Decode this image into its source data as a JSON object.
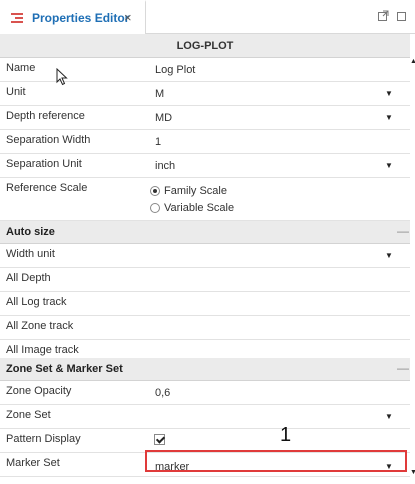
{
  "tab": {
    "title": "Properties Editor",
    "close": "×"
  },
  "header": {
    "title": "LOG-PLOT"
  },
  "rows": {
    "name": {
      "label": "Name",
      "value": "Log Plot"
    },
    "unit": {
      "label": "Unit",
      "value": "M"
    },
    "depth_reference": {
      "label": "Depth reference",
      "value": "MD"
    },
    "separation_width": {
      "label": "Separation Width",
      "value": "1"
    },
    "separation_unit": {
      "label": "Separation Unit",
      "value": "inch"
    },
    "reference_scale": {
      "label": "Reference Scale",
      "options": [
        "Family Scale",
        "Variable Scale"
      ],
      "selected": "Family Scale"
    }
  },
  "auto_size": {
    "title": "Auto size",
    "collapse": "—",
    "rows": {
      "width_unit": {
        "label": "Width unit",
        "value": ""
      },
      "all_depth": {
        "label": "All Depth"
      },
      "all_log_track": {
        "label": "All Log track"
      },
      "all_zone_track": {
        "label": "All Zone track"
      },
      "all_image_track": {
        "label": "All Image track"
      }
    }
  },
  "zone_marker": {
    "title": "Zone Set & Marker Set",
    "collapse": "—",
    "rows": {
      "zone_opacity": {
        "label": "Zone Opacity",
        "value": "0,6"
      },
      "zone_set": {
        "label": "Zone Set",
        "value": ""
      },
      "pattern_display": {
        "label": "Pattern Display",
        "checked": true
      },
      "marker_set": {
        "label": "Marker Set",
        "value": "marker"
      }
    }
  },
  "annotation": {
    "label": "1",
    "color": "#e03a3a"
  },
  "dropdown_arrow": "▼",
  "colors": {
    "accent": "#1f6fb5",
    "section_bg": "#ebebeb",
    "highlight": "#e03a3a"
  }
}
